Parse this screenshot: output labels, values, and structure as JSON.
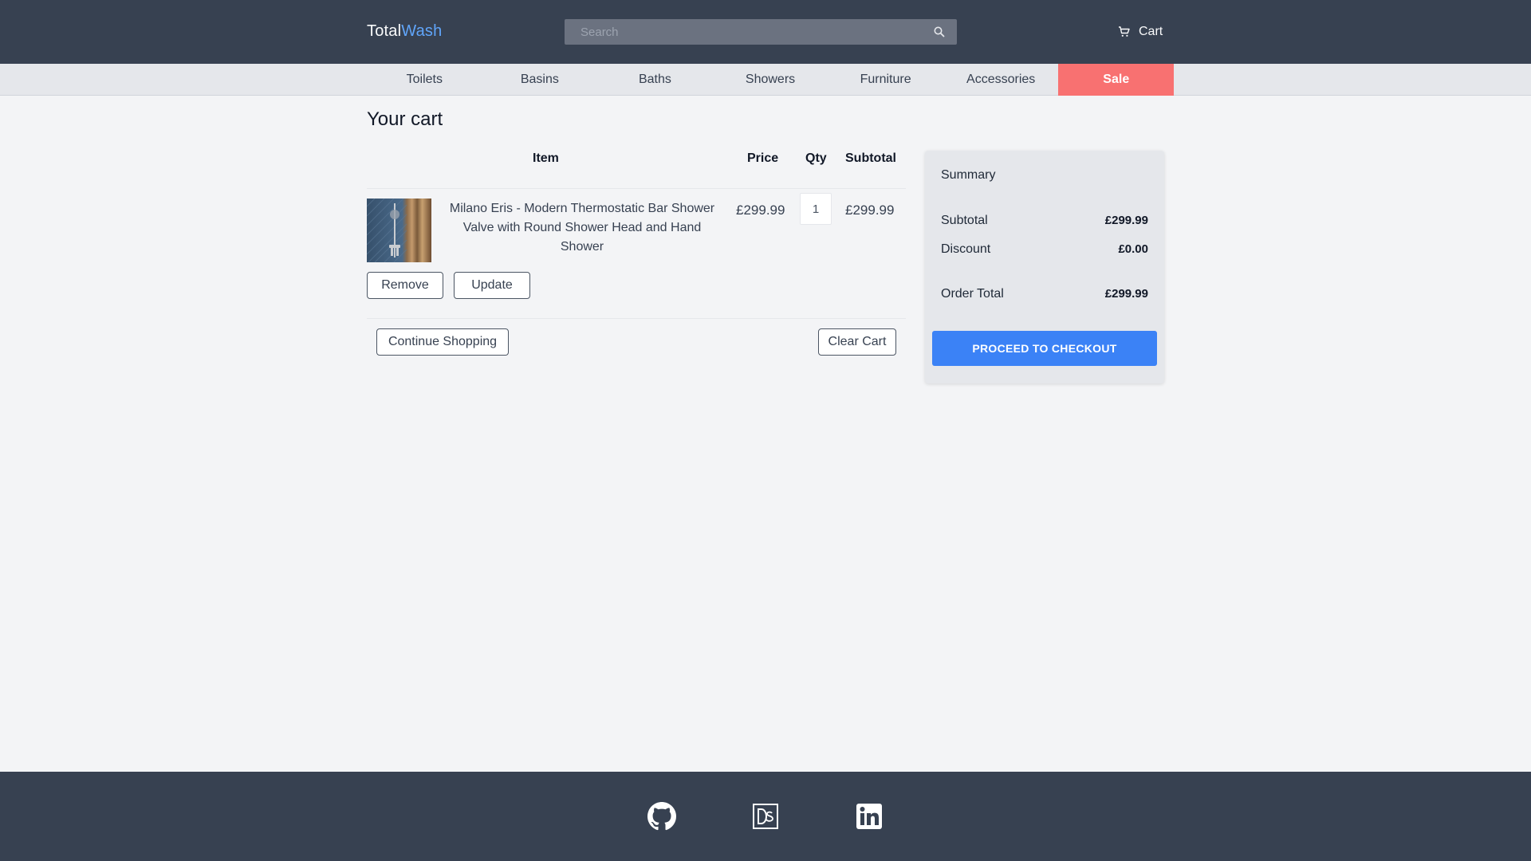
{
  "header": {
    "logo_part1": "Total",
    "logo_part2": "Wash",
    "search_placeholder": "Search",
    "cart_label": "Cart"
  },
  "nav": {
    "items": [
      "Toilets",
      "Basins",
      "Baths",
      "Showers",
      "Furniture",
      "Accessories",
      "Sale"
    ]
  },
  "cart": {
    "title": "Your cart",
    "columns": {
      "item": "Item",
      "price": "Price",
      "qty": "Qty",
      "subtotal": "Subtotal"
    },
    "items": [
      {
        "name": "Milano Eris - Modern Thermostatic Bar Shower Valve with Round Shower Head and Hand Shower",
        "price": "£299.99",
        "qty": "1",
        "subtotal": "£299.99"
      }
    ],
    "remove_label": "Remove",
    "update_label": "Update",
    "continue_label": "Continue Shopping",
    "clear_label": "Clear Cart"
  },
  "summary": {
    "title": "Summary",
    "subtotal_label": "Subtotal",
    "subtotal_value": "£299.99",
    "discount_label": "Discount",
    "discount_value": "£0.00",
    "total_label": "Order Total",
    "total_value": "£299.99",
    "checkout_label": "PROCEED TO CHECKOUT"
  },
  "footer": {
    "icons": [
      "github-icon",
      "ds-logo-icon",
      "linkedin-icon"
    ]
  },
  "colors": {
    "header_bg": "#374151",
    "accent_blue": "#60a5fa",
    "sale_red": "#f87171",
    "checkout_blue": "#3b82f6"
  }
}
